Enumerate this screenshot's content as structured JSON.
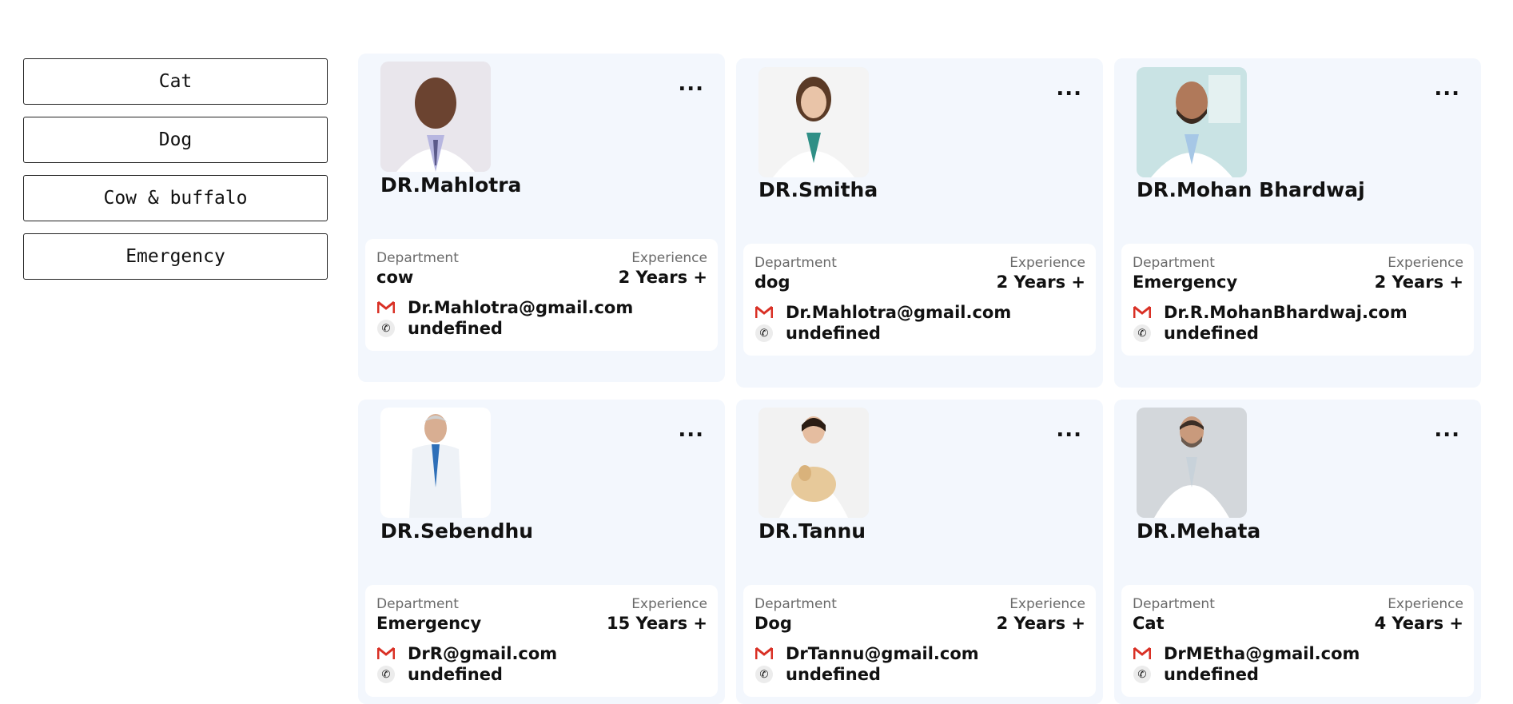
{
  "filters": [
    "Cat",
    "Dog",
    "Cow & buffalo",
    "Emergency"
  ],
  "cards": [
    {
      "name": "DR.Mahlotra",
      "dept_label": "Department",
      "dept": "cow",
      "exp_label": "Experience",
      "exp": "2 Years +",
      "email": "Dr.Mahlotra@gmail.com",
      "phone": "undefined"
    },
    {
      "name": "DR.Smitha",
      "dept_label": "Department",
      "dept": "dog",
      "exp_label": "Experience",
      "exp": "2 Years +",
      "email": "Dr.Mahlotra@gmail.com",
      "phone": "undefined"
    },
    {
      "name": "DR.Mohan Bhardwaj",
      "dept_label": "Department",
      "dept": "Emergency",
      "exp_label": "Experience",
      "exp": "2 Years +",
      "email": "Dr.R.MohanBhardwaj.com",
      "phone": "undefined"
    },
    {
      "name": "DR.Sebendhu",
      "dept_label": "Department",
      "dept": "Emergency",
      "exp_label": "Experience",
      "exp": "15 Years +",
      "email": "DrR@gmail.com",
      "phone": "undefined"
    },
    {
      "name": "DR.Tannu",
      "dept_label": "Department",
      "dept": "Dog",
      "exp_label": "Experience",
      "exp": "2 Years +",
      "email": "DrTannu@gmail.com",
      "phone": "undefined"
    },
    {
      "name": "DR.Mehata",
      "dept_label": "Department",
      "dept": "Cat",
      "exp_label": "Experience",
      "exp": "4 Years +",
      "email": "DrMEtha@gmail.com",
      "phone": "undefined"
    }
  ],
  "more_label": "...",
  "icons": {
    "email": "gmail-icon",
    "phone": "phone-icon",
    "more": "more-options-icon"
  },
  "colors": {
    "card_bg": "#f3f7fd",
    "info_bg": "#ffffff",
    "gmail_red": "#d93025"
  }
}
